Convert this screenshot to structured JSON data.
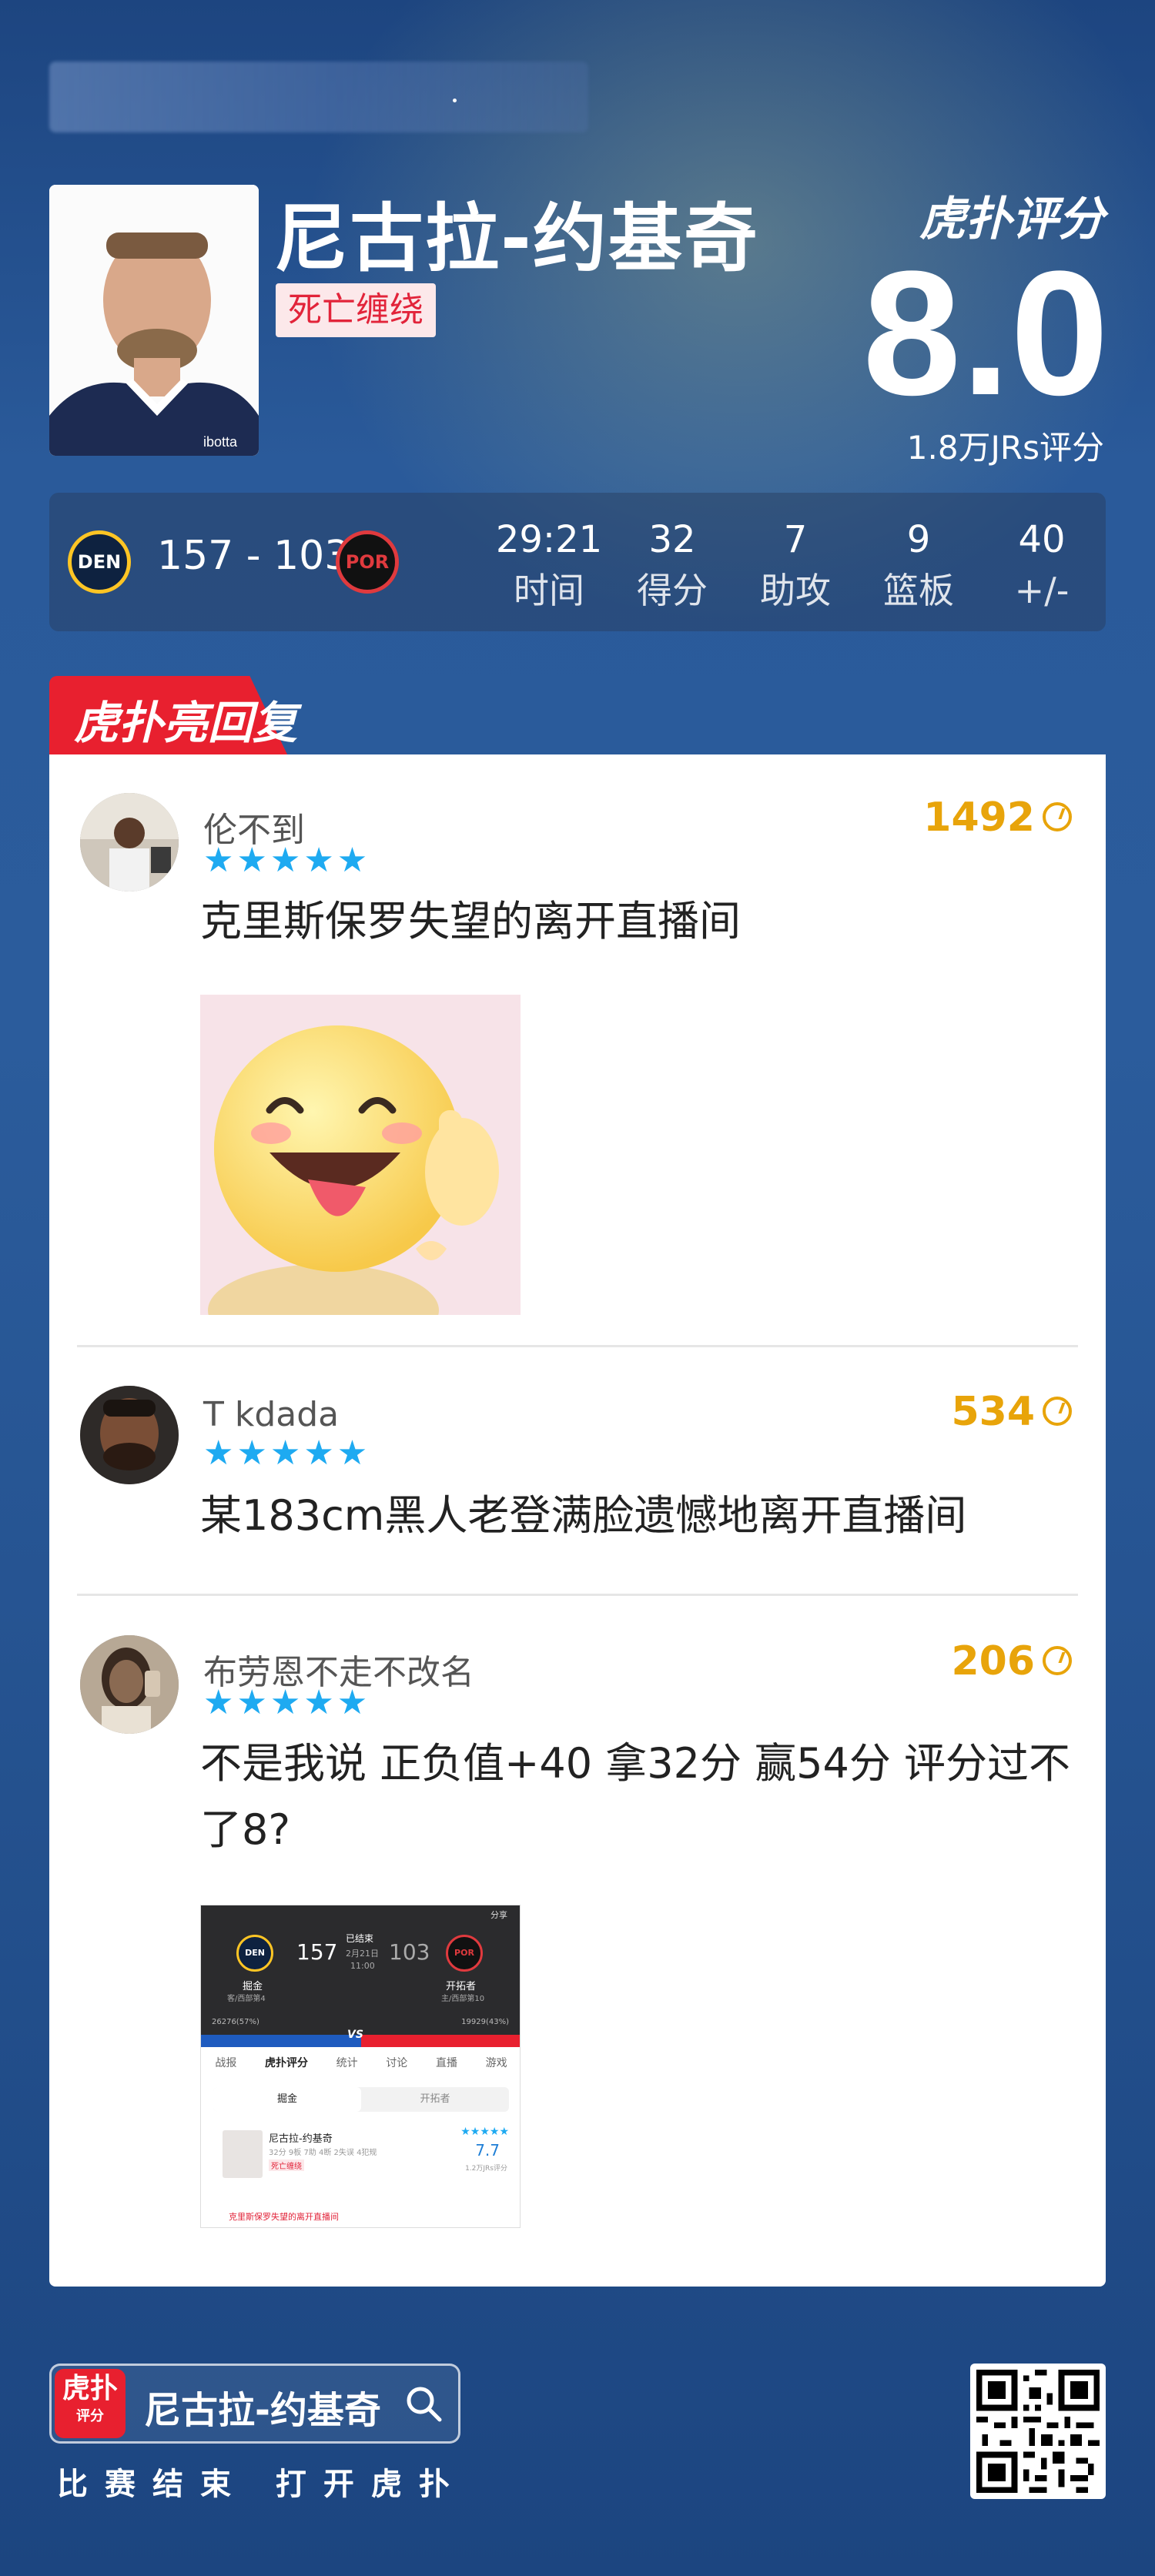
{
  "player": {
    "name": "尼古拉-约基奇",
    "tag": "死亡缠绕",
    "jersey_text": "ibotta"
  },
  "brand": {
    "logo_text": "虎扑评分"
  },
  "rating": {
    "score": "8.0",
    "count_text": "1.8万JRs评分"
  },
  "game": {
    "home_team_abbr": "DEN",
    "score_text": "157 - 103",
    "away_team_abbr": "POR"
  },
  "stats": [
    {
      "value": "29:21",
      "label": "时间"
    },
    {
      "value": "32",
      "label": "得分"
    },
    {
      "value": "7",
      "label": "助攻"
    },
    {
      "value": "9",
      "label": "篮板"
    },
    {
      "value": "40",
      "label": "+/-"
    }
  ],
  "section": {
    "title": "虎扑亮回复"
  },
  "comments": [
    {
      "username": "伦不到",
      "stars": "★★★★★",
      "likes": "1492",
      "text": "克里斯保罗失望的离开直播间"
    },
    {
      "username": "T kdada",
      "stars": "★★★★★",
      "likes": "534",
      "text": "某183cm黑人老登满脸遗憾地离开直播间"
    },
    {
      "username": "布劳恩不走不改名",
      "stars": "★★★★★",
      "likes": "206",
      "text": "不是我说 正负值+40 拿32分 赢54分 评分过不了8?"
    }
  ],
  "screenshot_preview": {
    "status": "已结束",
    "date": "2月21日",
    "time": "11:00",
    "home_name": "掘金",
    "home_rank": "客/西部第4",
    "away_name": "开拓者",
    "away_rank": "主/西部第10",
    "home_score": "157",
    "away_score": "103",
    "home_votes": "26276(57%)",
    "away_votes": "19929(43%)",
    "vs": "VS",
    "share": "分享",
    "tabs": [
      "战报",
      "虎扑评分",
      "统计",
      "讨论",
      "直播",
      "游戏"
    ],
    "team_btn_home": "掘金",
    "team_btn_away": "开拓者",
    "player_name": "尼古拉-约基奇",
    "player_stats": "32分 9板 7助 4断 2失误 4犯规",
    "player_tag": "死亡缠绕",
    "player_score": "7.7",
    "player_count": "1.2万JRs评分",
    "comment": "克里斯保罗失望的离开直播间"
  },
  "footer": {
    "app_icon_text": "虎扑",
    "app_icon_sub": "评分",
    "search_name": "尼古拉-约基奇",
    "hint": "比赛结束 打开虎扑"
  }
}
